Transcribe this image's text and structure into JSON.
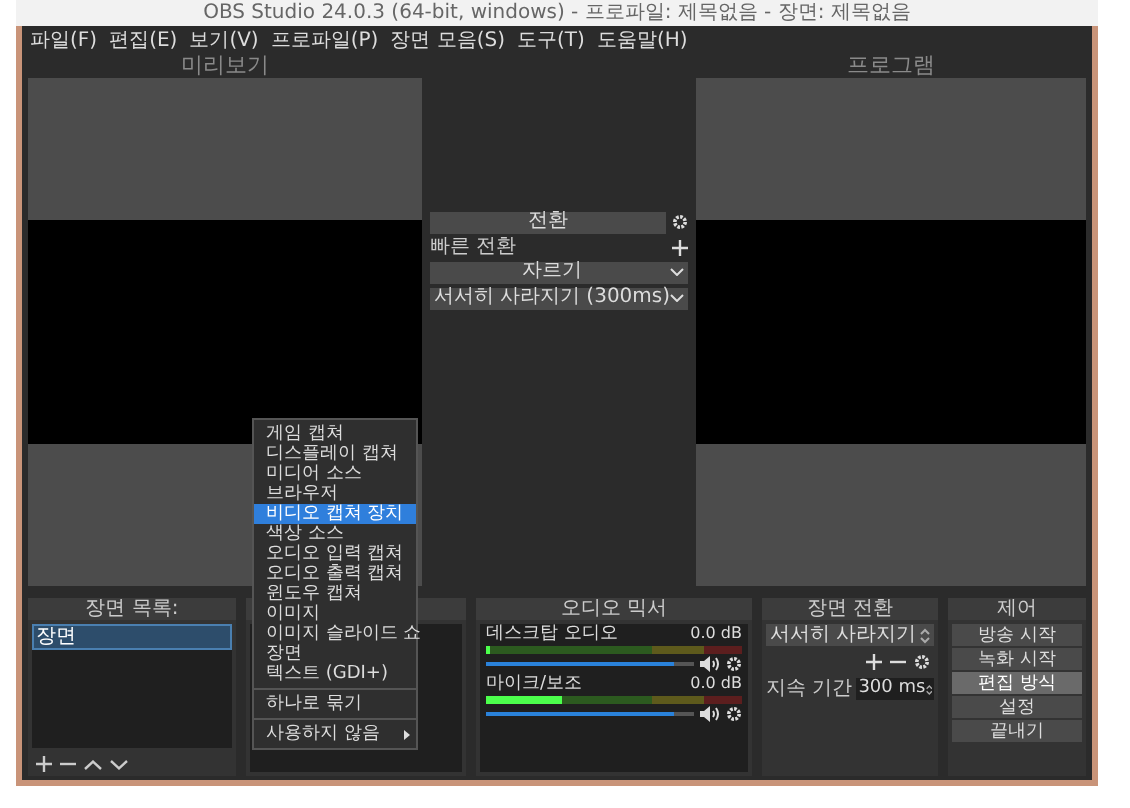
{
  "window": {
    "title": "OBS Studio 24.0.3 (64-bit, windows) - 프로파일: 제목없음 - 장면: 제목없음"
  },
  "menu": [
    "파일(F)",
    "편집(E)",
    "보기(V)",
    "프로파일(P)",
    "장면 모음(S)",
    "도구(T)",
    "도움말(H)"
  ],
  "preview": {
    "title": "미리보기"
  },
  "program": {
    "title": "프로그램"
  },
  "quick_transitions": {
    "transition_button": "전환",
    "quick_label": "빠른 전환",
    "dropdowns": [
      "자르기",
      "서서히 사라지기 (300ms)"
    ]
  },
  "scenes": {
    "title": "장면 목록:",
    "items": [
      {
        "label": "장면",
        "selected": true
      }
    ]
  },
  "context_menu": {
    "items": [
      {
        "kind": "item",
        "label": "게임 캡쳐",
        "selected": false
      },
      {
        "kind": "item",
        "label": "디스플레이 캡쳐",
        "selected": false
      },
      {
        "kind": "item",
        "label": "미디어 소스",
        "selected": false
      },
      {
        "kind": "item",
        "label": "브라우저",
        "selected": false
      },
      {
        "kind": "item",
        "label": "비디오 캡쳐 장치",
        "selected": true
      },
      {
        "kind": "item",
        "label": "색상 소스",
        "selected": false
      },
      {
        "kind": "item",
        "label": "오디오 입력 캡쳐",
        "selected": false
      },
      {
        "kind": "item",
        "label": "오디오 출력 캡쳐",
        "selected": false
      },
      {
        "kind": "item",
        "label": "윈도우 캡쳐",
        "selected": false
      },
      {
        "kind": "item",
        "label": "이미지",
        "selected": false
      },
      {
        "kind": "item",
        "label": "이미지 슬라이드 쇼",
        "selected": false
      },
      {
        "kind": "item",
        "label": "장면",
        "selected": false
      },
      {
        "kind": "item",
        "label": "텍스트 (GDI+)",
        "selected": false
      },
      {
        "kind": "separator"
      },
      {
        "kind": "item",
        "label": "하나로 묶기",
        "selected": false
      },
      {
        "kind": "separator"
      },
      {
        "kind": "submenu",
        "label": "사용하지 않음",
        "selected": false
      }
    ]
  },
  "mixer": {
    "title": "오디오 믹서",
    "channels": [
      {
        "name": "데스크탑 오디오",
        "reading": "0.0 dB",
        "meter": {
          "level": 0
        },
        "volume": {
          "level": 0.9
        }
      },
      {
        "name": "마이크/보조",
        "reading": "0.0 dB",
        "meter": {
          "level": 0.3
        },
        "volume": {
          "level": 0.9
        }
      }
    ]
  },
  "scene_transitions": {
    "title": "장면 전환",
    "transition": "서서히 사라지기",
    "duration_label": "지속 기간",
    "duration": "300 ms"
  },
  "controls": {
    "title": "제어",
    "buttons": [
      {
        "label": "방송 시작",
        "checked": false
      },
      {
        "label": "녹화 시작",
        "checked": false
      },
      {
        "label": "편집 방식",
        "checked": true
      },
      {
        "label": "설정",
        "checked": false
      },
      {
        "label": "끝내기",
        "checked": false
      }
    ]
  }
}
